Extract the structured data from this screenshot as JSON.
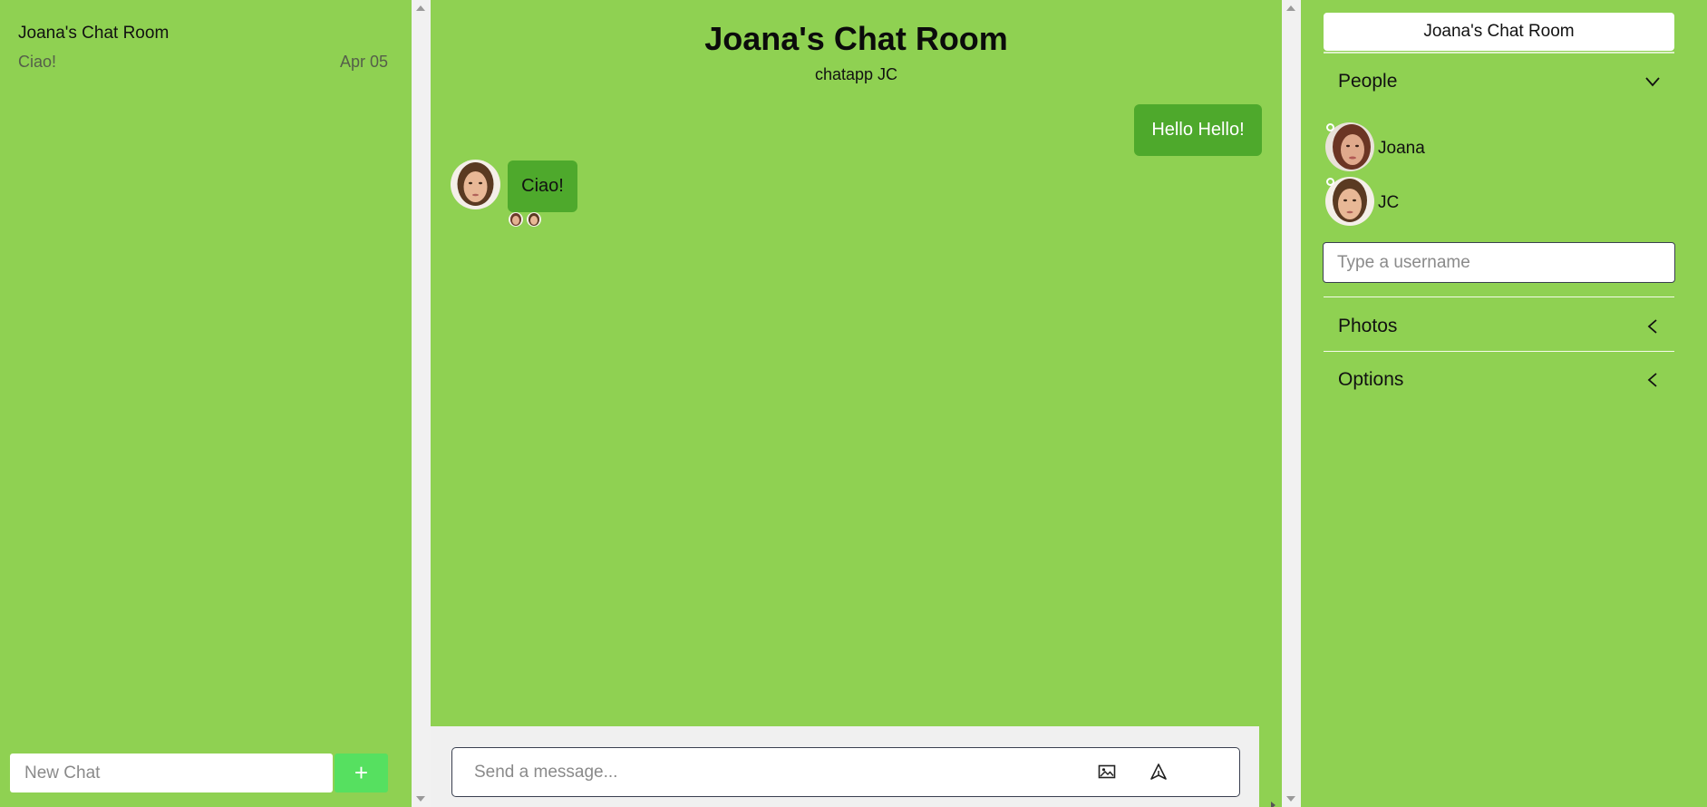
{
  "sidebar": {
    "chats": [
      {
        "title": "Joana's Chat Room",
        "preview": "Ciao!",
        "date": "Apr 05"
      }
    ],
    "new_chat": {
      "placeholder": "New Chat",
      "add_label": "+"
    }
  },
  "chat": {
    "title": "Joana's Chat Room",
    "subtitle": "chatapp JC",
    "messages": [
      {
        "direction": "out",
        "text": "Hello Hello!"
      },
      {
        "direction": "in",
        "text": "Ciao!"
      }
    ],
    "composer": {
      "placeholder": "Send a message...",
      "image_icon": "image-icon",
      "send_icon": "send-icon"
    }
  },
  "details": {
    "title": "Joana's Chat Room",
    "people": {
      "label": "People",
      "members": [
        {
          "name": "Joana"
        },
        {
          "name": "JC"
        }
      ],
      "input_placeholder": "Type a username"
    },
    "photos": {
      "label": "Photos"
    },
    "options": {
      "label": "Options"
    }
  },
  "colors": {
    "background": "#8fd152",
    "bubble": "#4ea92c",
    "new_chat_button": "#56e060",
    "scrollbar": "#f1f1f1"
  }
}
